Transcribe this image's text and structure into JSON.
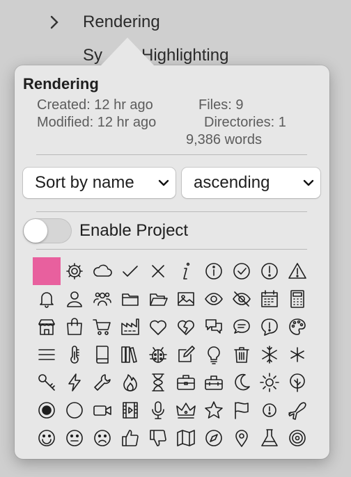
{
  "background": {
    "chevron": "›",
    "current_item": "Rendering",
    "next_item_start": "Sy",
    "next_item_end": "Highlighting"
  },
  "popover": {
    "title": "Rendering",
    "created": "Created: 12 hr ago",
    "modified": "Modified: 12 hr ago",
    "files": "Files: 9",
    "directories": "Directories: 1",
    "words": "9,386 words",
    "sort_by": "Sort by name",
    "sort_order": "ascending",
    "enable_label": "Enable Project",
    "enable_on": false,
    "accent_color": "#e8609e"
  },
  "icons": [
    "color-swatch",
    "gear-icon",
    "cloud-icon",
    "checkmark-icon",
    "xmark-icon",
    "italic-info-icon",
    "info-circle-icon",
    "check-circle-icon",
    "exclamation-circle-icon",
    "warning-triangle-icon",
    "bell-icon",
    "person-icon",
    "people-icon",
    "folder-icon",
    "open-folder-icon",
    "photo-icon",
    "eye-icon",
    "eye-slash-icon",
    "calendar-icon",
    "calculator-icon",
    "storefront-icon",
    "shopping-bag-icon",
    "cart-icon",
    "factory-icon",
    "heart-icon",
    "broken-heart-icon",
    "chat-bubbles-icon",
    "chat-lines-icon",
    "exclamation-bubble-icon",
    "palette-icon",
    "lines-icon",
    "thermometer-icon",
    "book-icon",
    "books-icon",
    "ladybug-icon",
    "compose-icon",
    "lightbulb-icon",
    "trash-icon",
    "snowflake-icon",
    "asterisk-icon",
    "key-icon",
    "bolt-icon",
    "wrench-icon",
    "flame-icon",
    "hourglass-icon",
    "briefcase-icon",
    "toolbox-icon",
    "moon-icon",
    "sun-icon",
    "tree-icon",
    "record-circle-icon",
    "circle-icon",
    "video-icon",
    "film-icon",
    "microphone-icon",
    "crown-icon",
    "star-icon",
    "flag-icon",
    "exclamation-small-icon",
    "airplane-icon",
    "smiley-icon",
    "neutral-face-icon",
    "frown-icon",
    "thumbs-up-icon",
    "thumbs-down-icon",
    "map-icon",
    "compass-icon",
    "map-pin-icon",
    "flask-icon",
    "record-disc-icon"
  ]
}
